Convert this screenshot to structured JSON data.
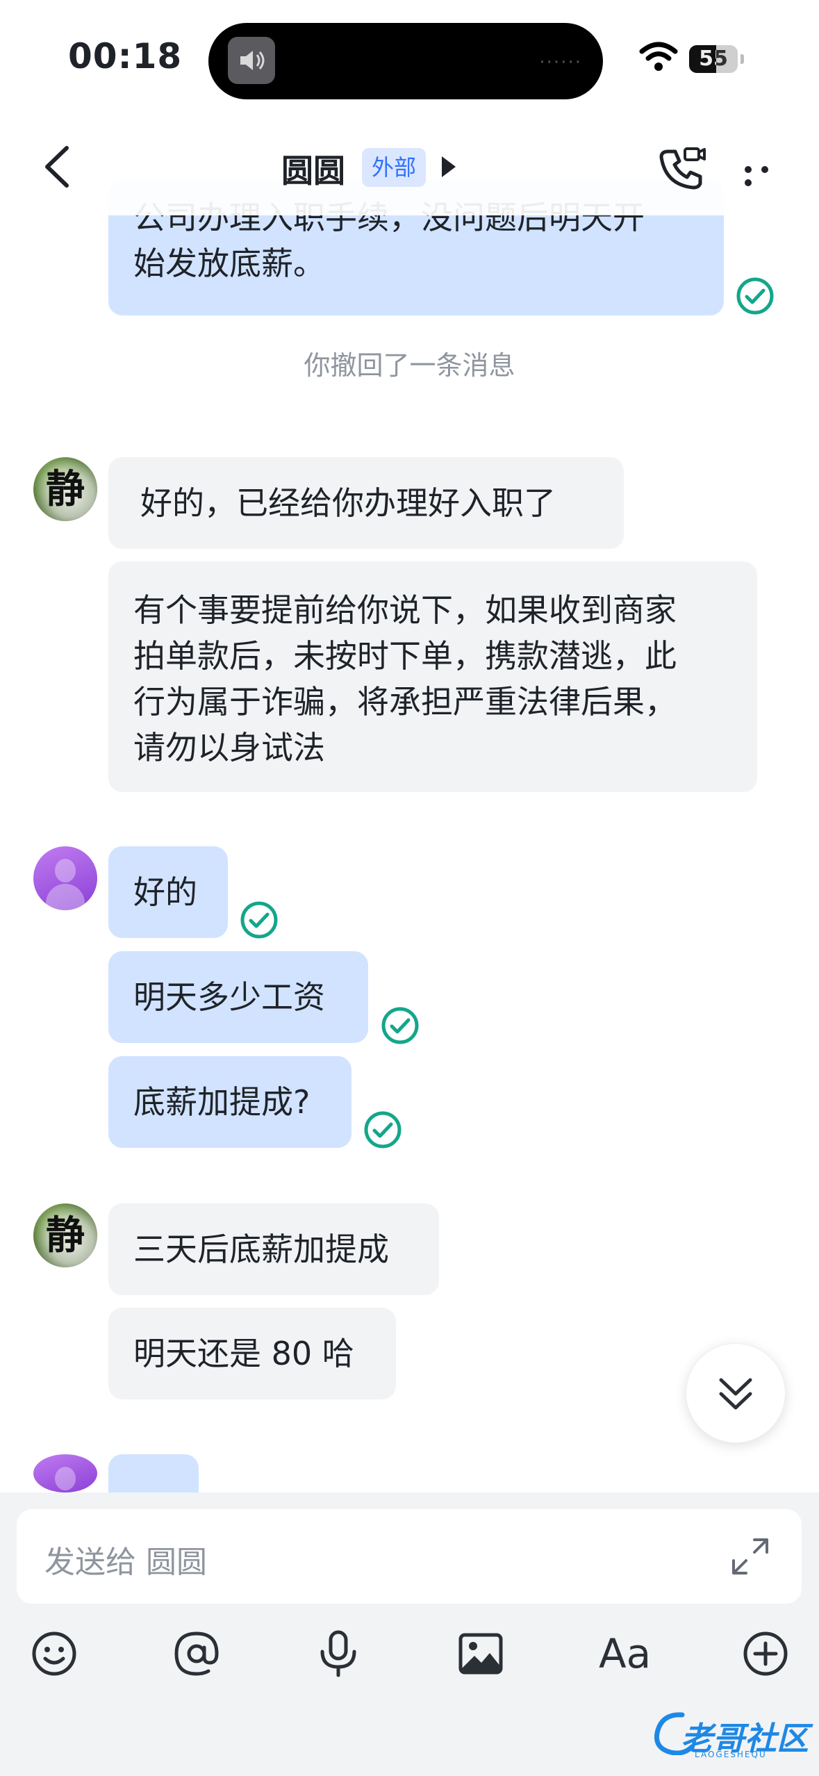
{
  "status_bar": {
    "time": "00:18",
    "battery": "55",
    "battery_level": 0.55
  },
  "nav": {
    "title": "圆圆",
    "badge": "外部"
  },
  "messages": {
    "m1_line1": "公司办理入职手续，没问题后明天开",
    "m1_line2": "始发放底薪。",
    "system_recall": "你撤回了一条消息",
    "m2": "好的，已经给你办理好入职了",
    "m3_lines": [
      "有个事要提前给你说下，如果收到商家",
      "拍单款后，未按时下单，携款潜逃，此",
      "行为属于诈骗，将承担严重法律后果，",
      "请勿以身试法"
    ],
    "m4": "好的",
    "m5": "明天多少工资",
    "m6": "底薪加提成?",
    "m7": "三天后底薪加提成",
    "m8": "明天还是 80 哈"
  },
  "avatars": {
    "them_glyph": "静"
  },
  "composer": {
    "placeholder": "发送给 圆圆",
    "font_tool": "Aa"
  },
  "watermark": {
    "text": "老哥社区",
    "sub": "LAOGESHEQU"
  },
  "colors": {
    "accent": "#3370ff",
    "bubble_me": "#d1e3ff",
    "bubble_them": "#f2f3f5",
    "read_check": "#14a68a"
  },
  "icons": [
    "back-icon",
    "phone-video-icon",
    "more-icon",
    "read-check-icon",
    "double-chevron-down-icon",
    "expand-icon",
    "emoji-icon",
    "mention-icon",
    "mic-icon",
    "image-icon",
    "font-icon",
    "plus-circle-icon",
    "wifi-icon",
    "battery-icon"
  ]
}
